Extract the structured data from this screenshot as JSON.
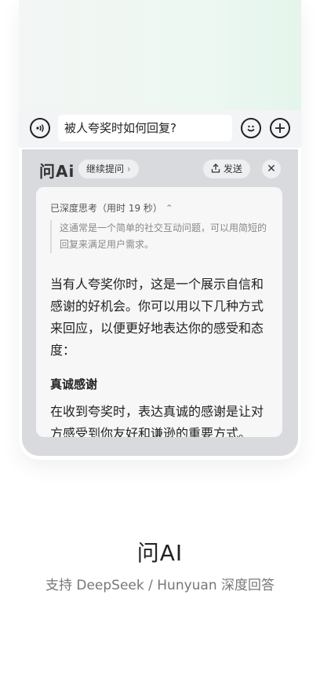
{
  "composer": {
    "input_value": "被人夸奖时如何回复?",
    "voice_icon": "voice-wave-icon",
    "emoji_icon": "emoji-icon",
    "add_icon": "plus-icon"
  },
  "assistant_panel": {
    "logo": "问Ai",
    "follow_up_label": "继续提问",
    "send_label": "发送",
    "share_icon": "share-icon",
    "close_icon": "close-icon",
    "thinking_label": "已深度思考（用时 19 秒）",
    "thinking_text": "这通常是一个简单的社交互动问题，可以用简短的回复来满足用户需求。",
    "answer_intro": "当有人夸奖你时，这是一个展示自信和感谢的好机会。你可以用以下几种方式来回应，以便更好地表达你的感受和态度：",
    "section_title": "真诚感谢",
    "section_text": "在收到夸奖时，表达真诚的感谢是让对方感受到你友好和谦逊的重要方式。"
  },
  "hero": {
    "title": "问AI",
    "subtitle": "支持 DeepSeek / Hunyuan 深度回答"
  }
}
